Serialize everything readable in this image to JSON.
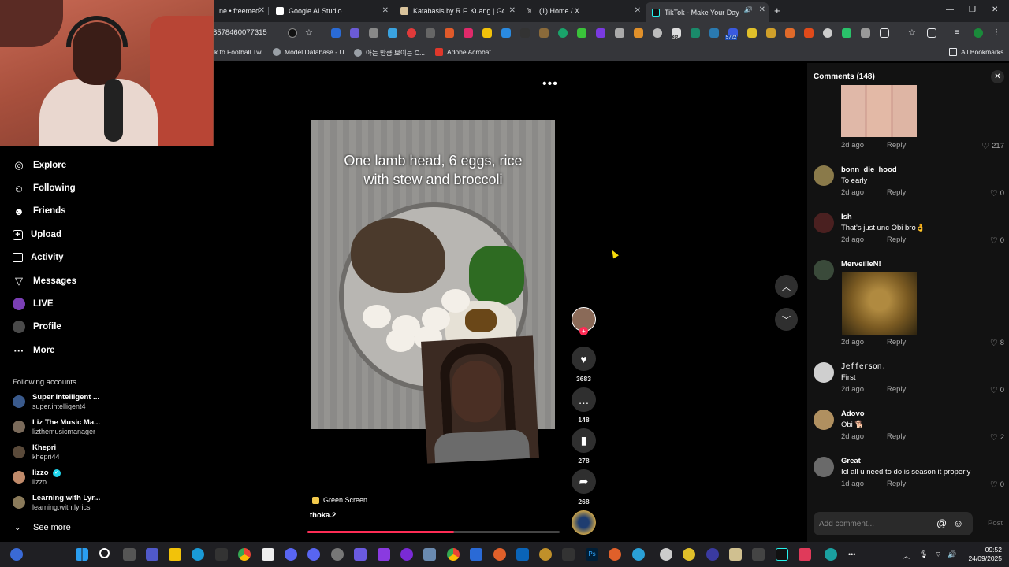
{
  "browser": {
    "tabs": [
      {
        "label": "ne • freemed",
        "color": "#7aa3d4"
      },
      {
        "label": "Google AI Studio",
        "color": "#ffffff"
      },
      {
        "label": "Katabasis by R.F. Kuang | Good",
        "color": "#d9c39c"
      },
      {
        "label": "(1) Home / X",
        "color": "#ffffff"
      },
      {
        "label": "TikTok - Make Your Day",
        "color": "#25f4ee"
      }
    ],
    "url": "8578460077315",
    "bookmarks": [
      {
        "label": "k to Football Twi...",
        "color": "#c9c9c9"
      },
      {
        "label": "Model Database - U...",
        "color": "#9aa0a6"
      },
      {
        "label": "아는 만큼 보이는 C...",
        "color": "#9aa0a6"
      },
      {
        "label": "Adobe Acrobat",
        "color": "#e0382b"
      }
    ],
    "all_bookmarks": "All Bookmarks",
    "extension_badge": "5722",
    "extension_badge_2": "36"
  },
  "sidebar": {
    "items": [
      {
        "label": "Explore",
        "icon": "compass-icon",
        "glyph": "◎"
      },
      {
        "label": "Following",
        "icon": "following-icon",
        "glyph": "👤"
      },
      {
        "label": "Friends",
        "icon": "friends-icon",
        "glyph": "👥"
      },
      {
        "label": "Upload",
        "icon": "upload-icon",
        "glyph": "⊞"
      },
      {
        "label": "Activity",
        "icon": "activity-icon",
        "glyph": "▢"
      },
      {
        "label": "Messages",
        "icon": "messages-icon",
        "glyph": "▽"
      },
      {
        "label": "LIVE",
        "icon": "live-icon",
        "glyph": ""
      },
      {
        "label": "Profile",
        "icon": "profile-icon",
        "glyph": ""
      },
      {
        "label": "More",
        "icon": "more-icon",
        "glyph": "···"
      }
    ],
    "following_heading": "Following accounts",
    "accounts": [
      {
        "name": "Super Intelligent ...",
        "handle": "super.intelligent4",
        "color": "#3a5a8c"
      },
      {
        "name": "Liz The Music Ma...",
        "handle": "lizthemusicmanager",
        "color": "#7a6a5a"
      },
      {
        "name": "Khepri",
        "handle": "khepri44",
        "color": "#5a4a3a"
      },
      {
        "name": "lizzo",
        "handle": "lizzo",
        "color": "#c08a6a"
      },
      {
        "name": "Learning with Lyr...",
        "handle": "learning.with.lyrics",
        "color": "#8a7a5a"
      }
    ],
    "see_more": "See more"
  },
  "video": {
    "caption_line1": "One lamb head, 6 eggs, rice",
    "caption_line2": "with stew and broccoli",
    "effect": "Green Screen",
    "author": "thoka.2",
    "progress": 0.58,
    "likes": "3683",
    "comments": "148",
    "saves": "278",
    "shares": "268"
  },
  "comments_panel": {
    "title": "Comments (148)",
    "placeholder": "Add comment...",
    "post": "Post",
    "reply_label": "Reply",
    "first": {
      "time": "2d ago",
      "likes": "217"
    },
    "items": [
      {
        "user": "bonn_die_hood",
        "text": "To early",
        "time": "2d ago",
        "likes": "0",
        "color": "#8a7a4a"
      },
      {
        "user": "Ish",
        "text": "That's just unc Obi bro👌",
        "time": "2d ago",
        "likes": "0",
        "color": "#4a2020"
      },
      {
        "user": "MerveilleN!",
        "text": "",
        "time": "2d ago",
        "likes": "8",
        "color": "#3a4a3a"
      },
      {
        "user": "Jefferson.",
        "text": "First",
        "time": "2d ago",
        "likes": "0",
        "color": "#cfcfcf"
      },
      {
        "user": "Adovo",
        "text": "Obi 🐕",
        "time": "2d ago",
        "likes": "2",
        "color": "#b09060"
      },
      {
        "user": "Great",
        "text": "Icl all u need to do is season it properly",
        "time": "1d ago",
        "likes": "0",
        "color": "#6a6a6a"
      }
    ]
  },
  "taskbar": {
    "time": "09:52",
    "date": "24/09/2025"
  }
}
